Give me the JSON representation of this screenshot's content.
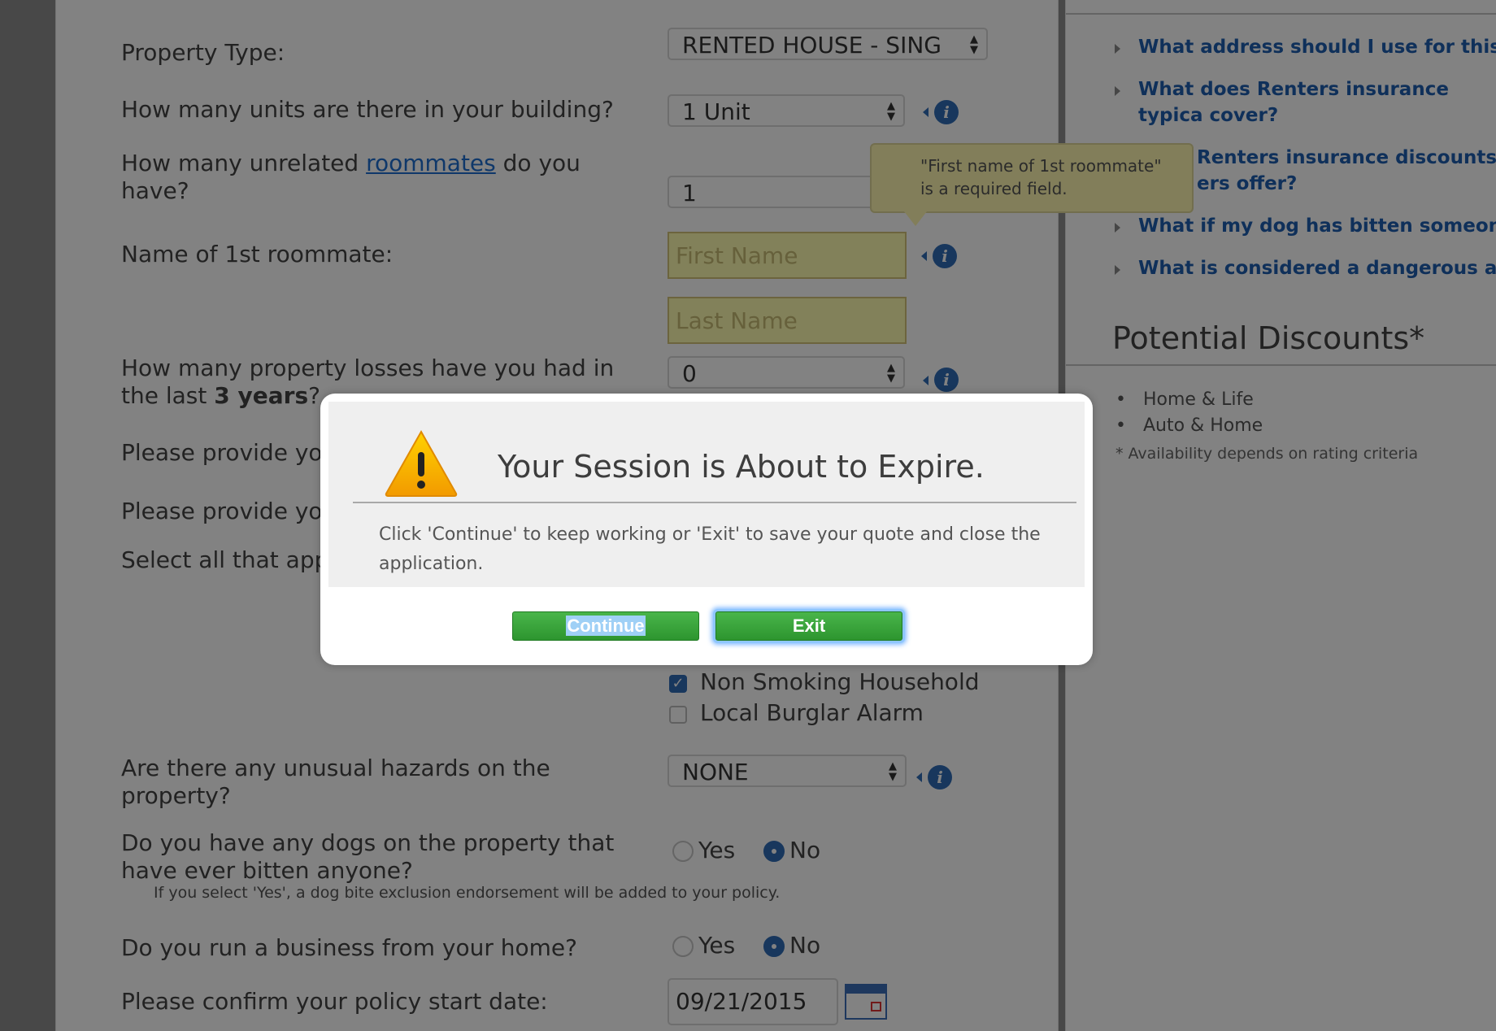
{
  "form": {
    "property_type": {
      "label": "Property Type:",
      "value": "RENTED HOUSE - SING"
    },
    "units": {
      "label": "How many units are there in your building?",
      "value": "1 Unit"
    },
    "roommates": {
      "label_pre": "How many unrelated ",
      "link": "roommates",
      "label_post": " do you have?",
      "value": "1"
    },
    "roommate_name": {
      "label": "Name of 1st roommate:",
      "first_placeholder": "First Name",
      "last_placeholder": "Last Name"
    },
    "losses": {
      "label_pre": "How many property losses have you had in the last ",
      "label_bold": "3 years",
      "label_post": "?",
      "value": "0"
    },
    "provide1": {
      "label": "Please provide yo"
    },
    "provide2": {
      "label": "Please provide yo"
    },
    "select_all": {
      "label": "Select all that app"
    },
    "non_smoking": {
      "label": "Non Smoking Household",
      "checked": true
    },
    "burglar_alarm": {
      "label": "Local Burglar Alarm",
      "checked": false
    },
    "hazards": {
      "label": "Are there any unusual hazards on the property?",
      "value": "NONE"
    },
    "dogs": {
      "label": "Do you have any dogs on the property that have ever bitten anyone?",
      "yes": "Yes",
      "no": "No",
      "selected": "No",
      "note": "If you select 'Yes', a dog bite exclusion endorsement will be added to your policy."
    },
    "business": {
      "label": "Do you run a business from your home?",
      "yes": "Yes",
      "no": "No",
      "selected": "No"
    },
    "start_date": {
      "label": "Please confirm your policy start date:",
      "value": "09/21/2015"
    }
  },
  "tooltip": {
    "text": "\"First name of 1st roommate\" is a required field."
  },
  "info_icon_glyph": "i",
  "sidebar": {
    "faqs": [
      "What address should I use for this c",
      "What does Renters insurance typica cover?",
      "Renters insurance discounts c ers offer?",
      "What if my dog has bitten someone",
      "What is considered a dangerous ani"
    ],
    "discounts_title": "Potential Discounts*",
    "discounts": [
      "Home & Life",
      "Auto & Home"
    ],
    "discounts_note": "* Availability depends on rating criteria"
  },
  "modal": {
    "title": "Your Session is About to Expire.",
    "message": "Click 'Continue' to keep working or 'Exit' to save your quote and close the application.",
    "continue_label": "Continue",
    "exit_label": "Exit",
    "warning_glyph": "!"
  },
  "colors": {
    "button_green": "#2d952f",
    "info_blue": "#2f6cb7",
    "link_blue": "#1f5eb0",
    "required_yellow": "#fffeb0"
  }
}
